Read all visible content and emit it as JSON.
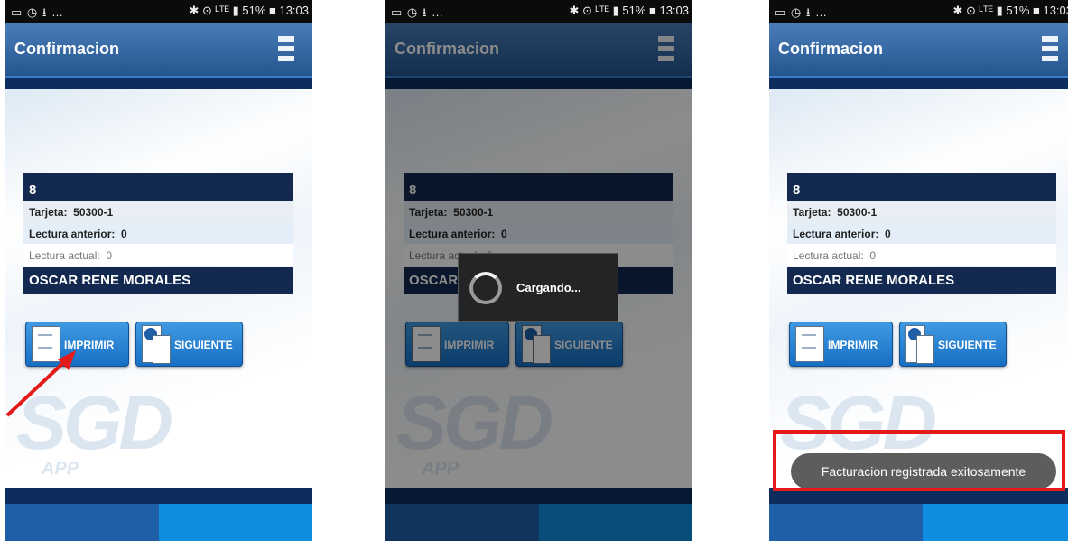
{
  "status_bar": {
    "left_icons": "▭ ◷ ⭳ …",
    "right_text": "✱ ⊙ ᴸᵀᴱ ▮ 51% ■ 13:03"
  },
  "app": {
    "title": "Confirmacion",
    "menu_icon": "hamburger-icon"
  },
  "record": {
    "number": "8",
    "tarjeta_label": "Tarjeta:",
    "tarjeta_value": "50300-1",
    "lectura_anterior_label": "Lectura anterior:",
    "lectura_anterior_value": "0",
    "lectura_actual_label": "Lectura actual:",
    "lectura_actual_value": "0",
    "customer_name": "OSCAR RENE MORALES"
  },
  "buttons": {
    "print_label": "IMPRIMIR",
    "next_label": "SIGUIENTE"
  },
  "watermark": {
    "text": "SGD",
    "sub": "APP"
  },
  "loading": {
    "text": "Cargando..."
  },
  "toast": {
    "text": "Facturacion registrada exitosamente"
  },
  "annotation_colors": {
    "arrow": "#e41a1a",
    "highlight_box": "#e41a1a"
  },
  "colors": {
    "app_bar": "#2f65a3",
    "dark_bar": "#13294f",
    "button": "#1e7fd1",
    "footer_light": "#0f8ee0"
  }
}
